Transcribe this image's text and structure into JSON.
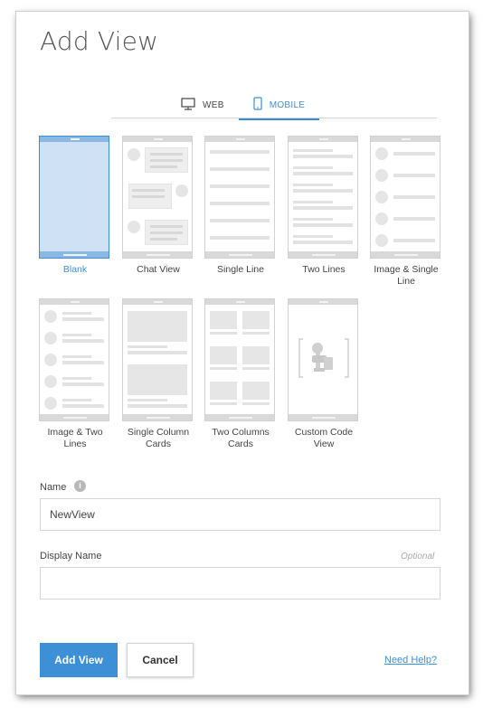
{
  "dialog": {
    "title": "Add View"
  },
  "tabs": [
    {
      "label": "WEB",
      "icon": "desktop-icon",
      "active": false
    },
    {
      "label": "MOBILE",
      "icon": "mobile-icon",
      "active": true
    }
  ],
  "templates": [
    {
      "label": "Blank",
      "selected": true
    },
    {
      "label": "Chat View",
      "selected": false
    },
    {
      "label": "Single Line",
      "selected": false
    },
    {
      "label": "Two Lines",
      "selected": false
    },
    {
      "label": "Image & Single Line",
      "selected": false
    },
    {
      "label": "Image & Two Lines",
      "selected": false
    },
    {
      "label": "Single Column Cards",
      "selected": false
    },
    {
      "label": "Two Columns Cards",
      "selected": false
    },
    {
      "label": "Custom Code View",
      "selected": false
    }
  ],
  "form": {
    "name_label": "Name",
    "name_value": "NewView",
    "display_name_label": "Display Name",
    "display_name_optional": "Optional",
    "display_name_value": ""
  },
  "footer": {
    "add_label": "Add View",
    "cancel_label": "Cancel",
    "help_label": "Need Help?"
  },
  "colors": {
    "accent": "#3d8fd6",
    "selected_fill": "#cfe2f5"
  }
}
